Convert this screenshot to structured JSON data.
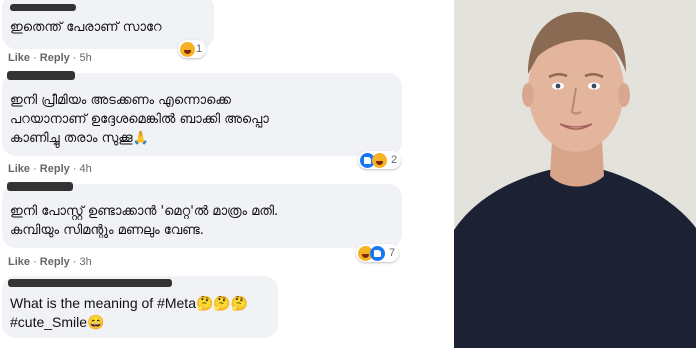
{
  "comments": [
    {
      "text": "ഇതെന്ത് പേരാണ് സാറേ",
      "actions": {
        "like": "Like",
        "reply": "Reply",
        "time": "5h"
      },
      "reaction": {
        "count": "1",
        "types": [
          "haha-icon"
        ]
      }
    },
    {
      "text": "ഇനി പ്രീമിയം അടക്കണം എന്നൊക്കെ\nപറയാനാണ് ഉദ്ദേശമെങ്കിൽ ബാക്കി അപ്പൊ\nകാണിച്ചു തരാം സുക്കൂ🙏",
      "actions": {
        "like": "Like",
        "reply": "Reply",
        "time": "4h"
      },
      "reaction": {
        "count": "2",
        "types": [
          "like-icon",
          "haha-icon"
        ]
      }
    },
    {
      "text": "ഇനി പോസ്റ്റ് ഉണ്ടാക്കാൻ 'മെറ്റ'ൽ മാത്രം മതി.\nകമ്പിയും സിമന്റും മണലും വേണ്ട.",
      "actions": {
        "like": "Like",
        "reply": "Reply",
        "time": "3h"
      },
      "reaction": {
        "count": "7",
        "types": [
          "haha-icon",
          "like-icon"
        ]
      }
    },
    {
      "text": "What is the meaning of #Meta🤔🤔🤔\n#cute_Smile😄",
      "actions": null,
      "reaction": null
    }
  ],
  "colors": {
    "bubble": "#f0f2f5",
    "meta_text": "#65676b",
    "like_blue": "#1877f2",
    "haha_yellow": "#f7b125",
    "photo_bg": "#e4e2dd",
    "sweater": "#1c2233"
  },
  "photo": {
    "subject": "person-portrait"
  }
}
